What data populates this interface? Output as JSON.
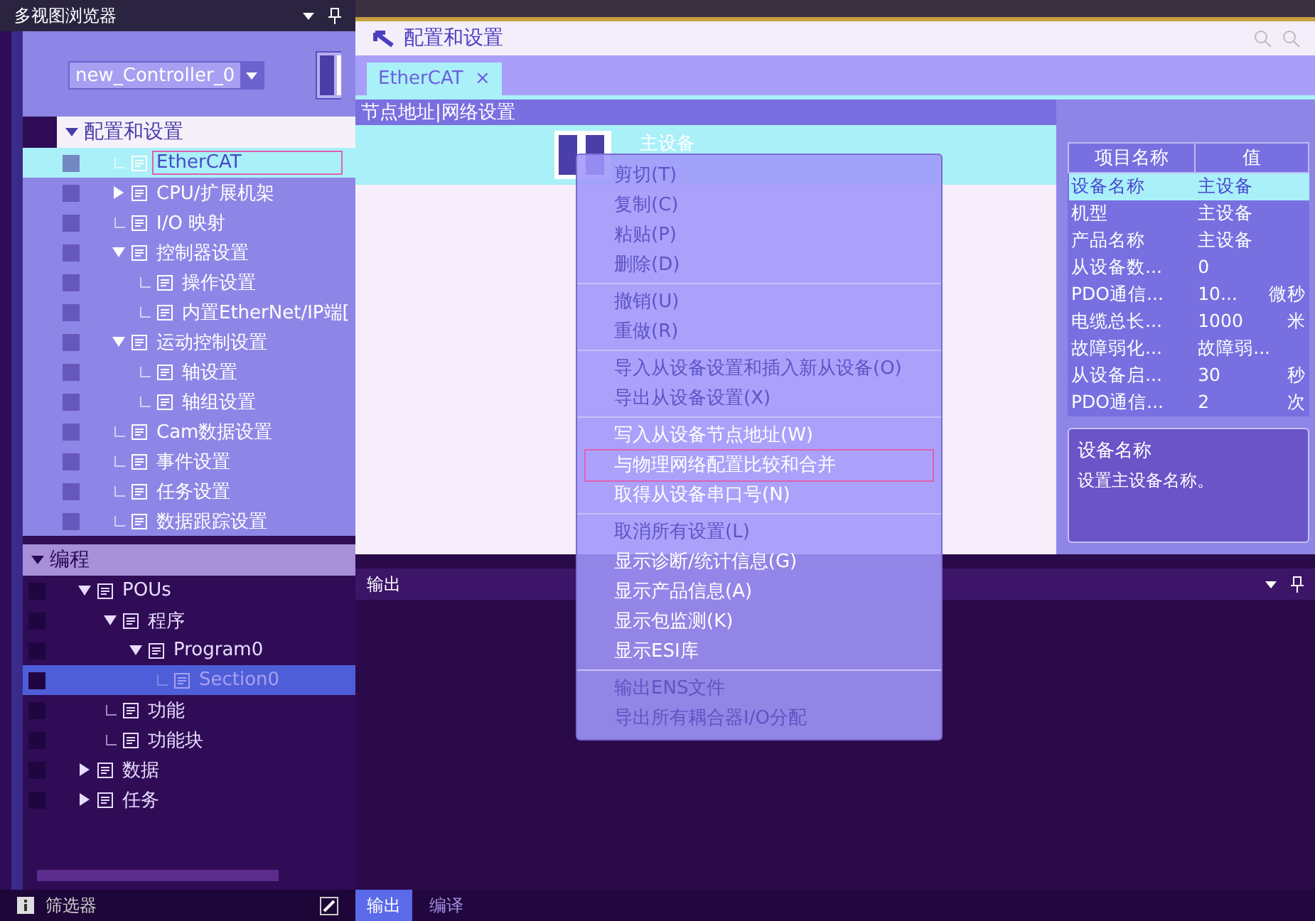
{
  "explorer": {
    "title": "多视图浏览器",
    "controller": "new_Controller_0",
    "tree": [
      {
        "label": "配置和设置",
        "expanded": true,
        "children": [
          {
            "label": "EtherCAT",
            "selected": true
          },
          {
            "label": "CPU/扩展机架",
            "expanded": false
          },
          {
            "label": "I/O 映射",
            "selected": false
          },
          {
            "label": "控制器设置",
            "expanded": true,
            "children": [
              {
                "label": "操作设置",
                "selected": false
              },
              {
                "label": "内置EtherNet/IP端[",
                "selected": false
              }
            ]
          },
          {
            "label": "运动控制设置",
            "expanded": true,
            "children": [
              {
                "label": "轴设置",
                "selected": false
              },
              {
                "label": "轴组设置",
                "selected": false
              }
            ]
          },
          {
            "label": "Cam数据设置",
            "selected": false
          },
          {
            "label": "事件设置",
            "selected": false
          },
          {
            "label": "任务设置",
            "selected": false
          },
          {
            "label": "数据跟踪设置",
            "selected": false
          }
        ]
      },
      {
        "label": "编程",
        "expanded": true,
        "children": [
          {
            "label": "POUs",
            "expanded": true,
            "children": [
              {
                "label": "程序",
                "expanded": true,
                "children": [
                  {
                    "label": "Program0",
                    "expanded": true,
                    "children": [
                      {
                        "label": "Section0",
                        "selected": true
                      }
                    ]
                  }
                ]
              },
              {
                "label": "功能",
                "selected": false
              },
              {
                "label": "功能块",
                "selected": false
              }
            ]
          },
          {
            "label": "数据",
            "expanded": false
          },
          {
            "label": "任务",
            "expanded": false
          }
        ]
      }
    ],
    "filter": "筛选器"
  },
  "editor": {
    "title": "配置和设置",
    "tabs": [
      {
        "label": "EtherCAT",
        "close": "×",
        "selected": true
      }
    ],
    "pane_title": "节点地址|网络设置",
    "master": "主设备",
    "properties": {
      "columns": [
        "项目名称",
        "值"
      ],
      "rows": [
        {
          "name": "设备名称",
          "value": "主设备",
          "unit": "",
          "selected": true
        },
        {
          "name": "机型",
          "value": "主设备",
          "unit": "",
          "selected": false
        },
        {
          "name": "产品名称",
          "value": "主设备",
          "unit": "",
          "selected": false
        },
        {
          "name": "从设备数...",
          "value": "0",
          "unit": "",
          "selected": false
        },
        {
          "name": "PDO通信...",
          "value": "10...",
          "unit": "微秒",
          "selected": false
        },
        {
          "name": "电缆总长...",
          "value": "1000",
          "unit": "米",
          "selected": false
        },
        {
          "name": "故障弱化...",
          "value": "故障弱...",
          "unit": "",
          "selected": false
        },
        {
          "name": "从设备启...",
          "value": "30",
          "unit": "秒",
          "selected": false
        },
        {
          "name": "PDO通信...",
          "value": "2",
          "unit": "次",
          "selected": false
        }
      ]
    },
    "description": {
      "title": "设备名称",
      "text": "设置主设备名称。"
    }
  },
  "context_menu": [
    {
      "kind": "item",
      "label": "剪切(T)",
      "disabled": true,
      "selected": false
    },
    {
      "kind": "item",
      "label": "复制(C)",
      "disabled": true,
      "selected": false
    },
    {
      "kind": "item",
      "label": "粘贴(P)",
      "disabled": true,
      "selected": false
    },
    {
      "kind": "item",
      "label": "删除(D)",
      "disabled": true,
      "selected": false
    },
    {
      "kind": "separator"
    },
    {
      "kind": "item",
      "label": "撤销(U)",
      "disabled": true,
      "selected": false
    },
    {
      "kind": "item",
      "label": "重做(R)",
      "disabled": true,
      "selected": false
    },
    {
      "kind": "separator"
    },
    {
      "kind": "item",
      "label": "导入从设备设置和插入新从设备(O)",
      "disabled": true,
      "selected": false
    },
    {
      "kind": "item",
      "label": "导出从设备设置(X)",
      "disabled": true,
      "selected": false
    },
    {
      "kind": "separator"
    },
    {
      "kind": "item",
      "label": "写入从设备节点地址(W)",
      "disabled": false,
      "selected": false
    },
    {
      "kind": "item",
      "label": "与物理网络配置比较和合并",
      "disabled": false,
      "selected": true
    },
    {
      "kind": "item",
      "label": "取得从设备串口号(N)",
      "disabled": false,
      "selected": false
    },
    {
      "kind": "separator"
    },
    {
      "kind": "item",
      "label": "取消所有设置(L)",
      "disabled": true,
      "selected": false
    },
    {
      "kind": "item",
      "label": "显示诊断/统计信息(G)",
      "disabled": false,
      "selected": false
    },
    {
      "kind": "item",
      "label": "显示产品信息(A)",
      "disabled": false,
      "selected": false
    },
    {
      "kind": "item",
      "label": "显示包监测(K)",
      "disabled": false,
      "selected": false
    },
    {
      "kind": "item",
      "label": "显示ESI库",
      "disabled": false,
      "selected": false
    },
    {
      "kind": "separator"
    },
    {
      "kind": "item",
      "label": "输出ENS文件",
      "disabled": true,
      "selected": false
    },
    {
      "kind": "item",
      "label": "导出所有耦合器I/O分配",
      "disabled": true,
      "selected": false
    }
  ],
  "output": {
    "title": "输出"
  },
  "bottom_tabs": [
    {
      "label": "输出",
      "selected": true
    },
    {
      "label": "编译",
      "selected": false
    }
  ]
}
